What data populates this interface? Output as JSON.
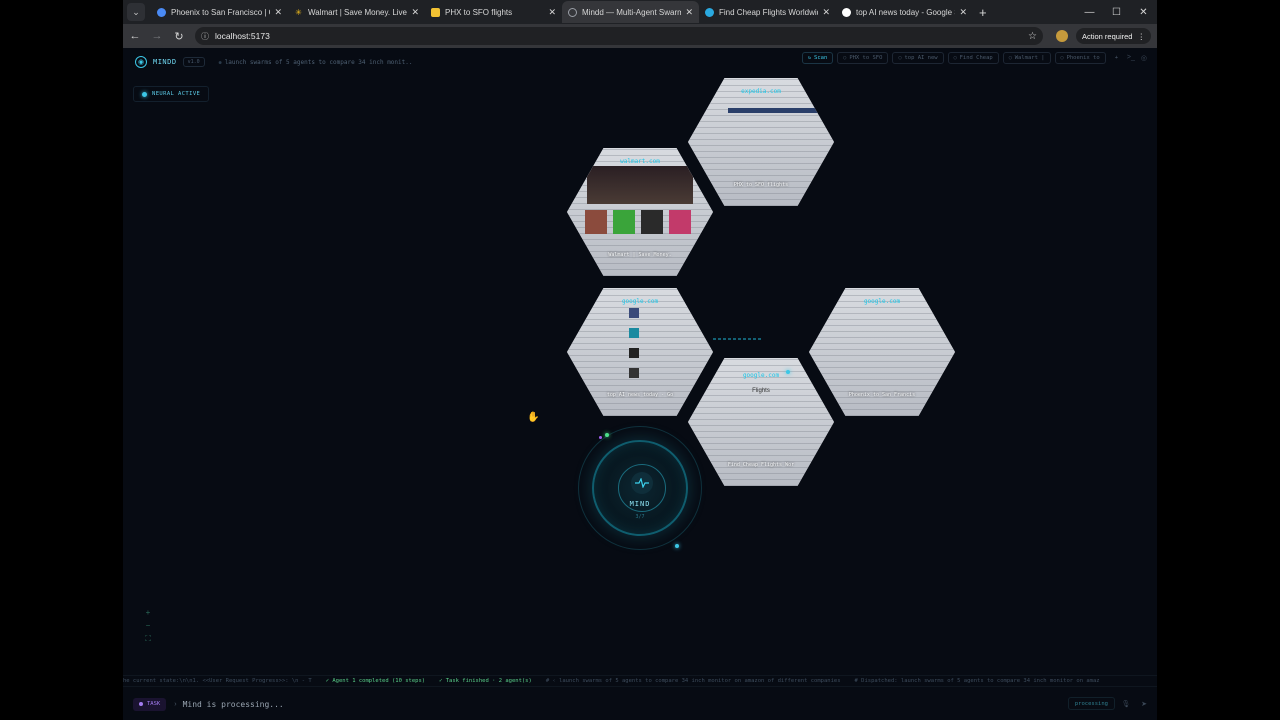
{
  "browser": {
    "tabs": [
      {
        "title": "Phoenix to San Francisco | Goo",
        "favicon_color": "#4a8af4",
        "active": false
      },
      {
        "title": "Walmart | Save Money. Live be",
        "favicon_color": "#f8c21c",
        "active": false
      },
      {
        "title": "PHX to SFO flights",
        "favicon_color": "#f2c233",
        "active": false
      },
      {
        "title": "Mindd — Multi-Agent Swarm",
        "favicon_color": "#6b6f78",
        "active": true
      },
      {
        "title": "Find Cheap Flights Worldwide",
        "favicon_color": "#2aa9e0",
        "active": false
      },
      {
        "title": "top AI news today - Google Sea",
        "favicon_color": "#4a8af4",
        "active": false
      }
    ],
    "url": "localhost:5173",
    "action_required": "Action required"
  },
  "app": {
    "logo": "MINDD",
    "version": "v1.0",
    "command": "launch swarms of 5 agents to compare 34 inch monit..",
    "pills": [
      "Scan",
      "PHX to SFO",
      "top AI new",
      "Find Cheap",
      "Walmart |",
      "Phoenix to"
    ],
    "neural_status": "NEURAL ACTIVE",
    "agents": [
      {
        "domain": "expedia.com",
        "caption": "PHX to SFO flights"
      },
      {
        "domain": "walmart.com",
        "caption": "Walmart | Save Money."
      },
      {
        "domain": "google.com",
        "caption": "top AI news today - Go"
      },
      {
        "domain": "google.com",
        "caption": "Phoenix to San Francis"
      },
      {
        "domain": "google.com",
        "caption": "Find Cheap Flights Wor",
        "sub": "Flights"
      }
    ],
    "core": {
      "label": "MIND",
      "count": "3/7"
    },
    "ticker": [
      {
        "text": "he current state:\\n\\n1. <<User Request Progress>>: \\n - T",
        "tone": "dim"
      },
      {
        "text": "✓ Agent 1 completed (10 steps)",
        "tone": "green"
      },
      {
        "text": "✓ Task finished · 2 agent(s)",
        "tone": "green"
      },
      {
        "text": "# ‹ launch swarms of 5 agents to compare 34 inch monitor on amazon of different companies",
        "tone": "dim"
      },
      {
        "text": "# Dispatched: launch swarms of 5 agents to compare 34 inch monitor on amaz",
        "tone": "dim"
      }
    ],
    "task_tag": "TASK",
    "task_text": "Mind is processing...",
    "status": "processing"
  }
}
